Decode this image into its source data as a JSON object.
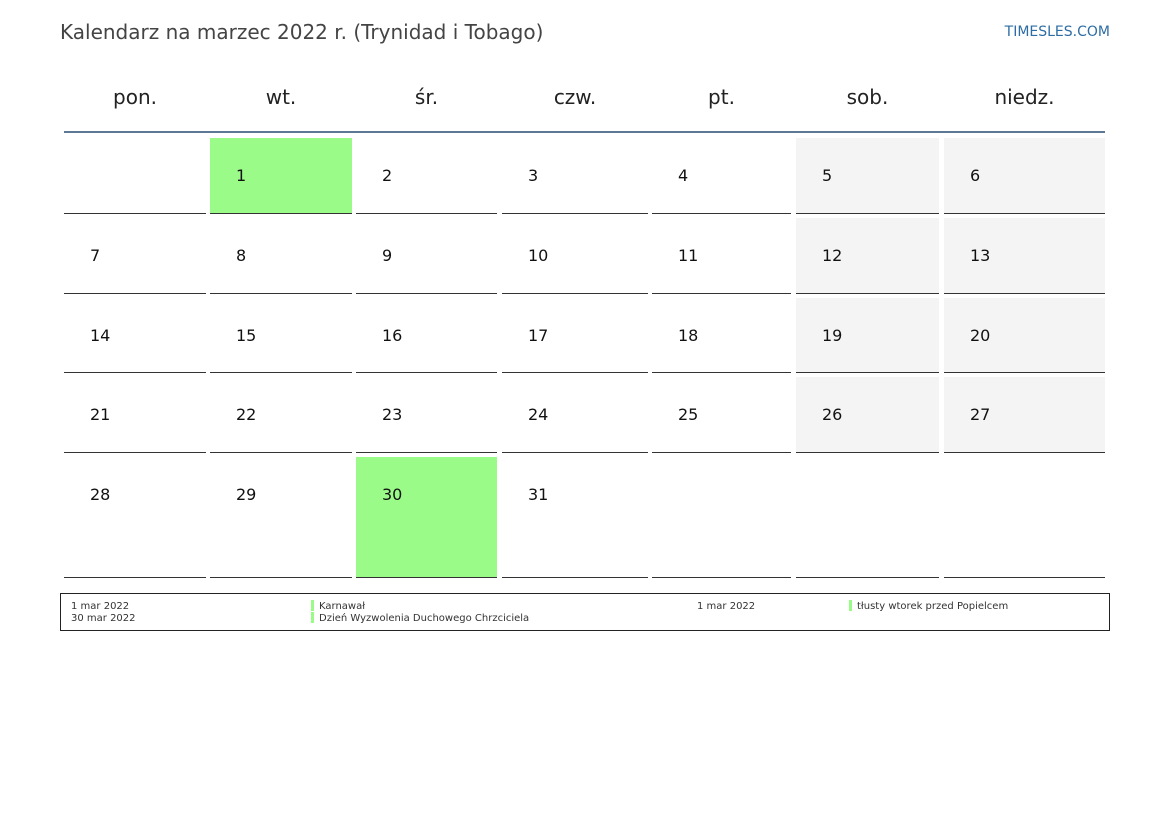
{
  "title": "Kalendarz na marzec 2022 r. (Trynidad i Tobago)",
  "site": "TIMESLES.COM",
  "weekdays": [
    "pon.",
    "wt.",
    "śr.",
    "czw.",
    "pt.",
    "sob.",
    "niedz."
  ],
  "weeks": [
    [
      "",
      "1",
      "2",
      "3",
      "4",
      "5",
      "6"
    ],
    [
      "7",
      "8",
      "9",
      "10",
      "11",
      "12",
      "13"
    ],
    [
      "14",
      "15",
      "16",
      "17",
      "18",
      "19",
      "20"
    ],
    [
      "21",
      "22",
      "23",
      "24",
      "25",
      "26",
      "27"
    ],
    [
      "28",
      "29",
      "30",
      "31",
      "",
      "",
      ""
    ]
  ],
  "holiday_days": [
    "1",
    "30"
  ],
  "colors": {
    "holiday": "#9bfb89",
    "weekend": "#f4f4f4",
    "header_rule": "#5b7896",
    "link": "#2e6da4"
  },
  "legend": {
    "left": [
      {
        "date": "1 mar 2022",
        "name": "Karnawał"
      },
      {
        "date": "30 mar 2022",
        "name": "Dzień Wyzwolenia Duchowego Chrzciciela"
      }
    ],
    "right": [
      {
        "date": "1 mar 2022",
        "name": "tłusty wtorek przed Popielcem"
      }
    ]
  }
}
